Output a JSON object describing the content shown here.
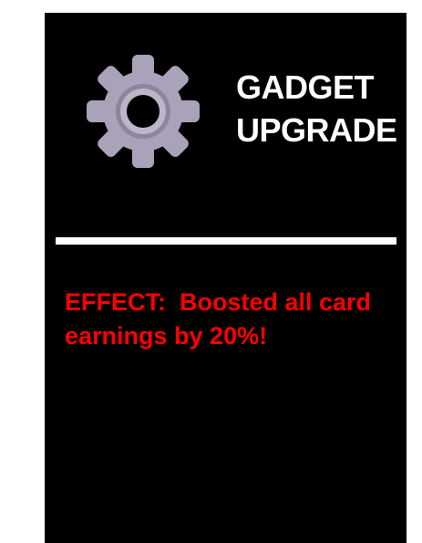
{
  "card": {
    "icon": "gear-icon",
    "title_line1": "GADGET",
    "title_line2": "UPGRADE",
    "effect_text": "EFFECT:  Boosted all card earnings by 20%!"
  },
  "colors": {
    "card_background": "#000000",
    "title": "#ffffff",
    "divider": "#ffffff",
    "effect": "#ff0000",
    "gear_outer": "#aaa2b8",
    "gear_ring": "#8d849e",
    "gear_inner": "#bdb6c9"
  }
}
